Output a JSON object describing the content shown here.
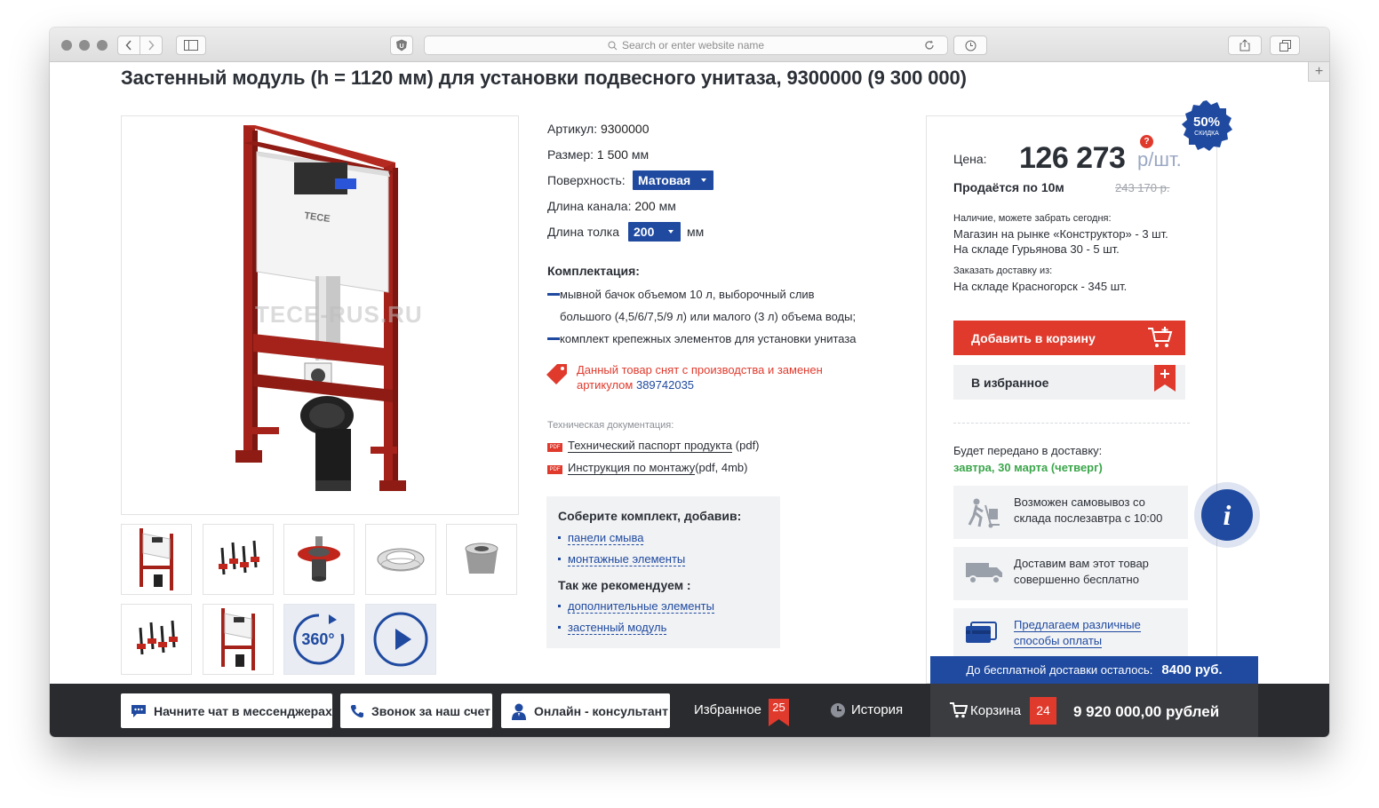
{
  "browser": {
    "address_placeholder": "Search or enter website name"
  },
  "product": {
    "title": "Застенный модуль (h = 1120 мм) для установки подвесного унитаза, 9300000 (9 300 000)",
    "watermark": "TECE-RUS.RU",
    "brand_mark": "TECE",
    "thumb_360": "360°"
  },
  "attributes": {
    "article_label": "Артикул:",
    "article_value": "9300000",
    "size_label": "Размер:",
    "size_value": "1 500",
    "size_unit": "мм",
    "surface_label": "Поверхность:",
    "surface_value": "Матовая",
    "channel_label": "Длина канала:",
    "channel_value": "200",
    "channel_unit": "мм",
    "push_label": "Длина толка",
    "push_value": "200",
    "push_unit": "мм"
  },
  "kit": {
    "title": "Комплектация:",
    "item1_line1": "мывной бачок объемом 10 л, выборочный слив",
    "item1_line2": "большого (4,5/6/7,5/9 л) или малого (3 л) объема воды;",
    "item2": "комплект крепежных элементов для установки унитаза"
  },
  "notice": {
    "line1": "Данный товар снят с производства и заменен",
    "line2_prefix": "артикулом",
    "replacement_article": "389742035"
  },
  "docs": {
    "heading": "Техническая документация:",
    "pdf_tag": "PDF",
    "doc1_link": "Технический паспорт продукта",
    "doc1_suffix": "(pdf)",
    "doc2_link": "Инструкция по монтажу",
    "doc2_suffix": "(pdf, 4mb)"
  },
  "combo": {
    "heading1": "Соберите комплект, добавив:",
    "link1": "панели смыва",
    "link2": "монтажные элементы",
    "heading2": "Так же рекомендуем :",
    "link3": "дополнительные элементы",
    "link4": "застенный модуль"
  },
  "pricing": {
    "discount": "50%",
    "discount_caption": "СКИДКА",
    "price_label": "Цена:",
    "price": "126 273",
    "unit": "р/шт.",
    "help": "?",
    "sold_by": "Продаётся по 10м",
    "old_price": "243 170 р."
  },
  "availability": {
    "heading": "Наличие, можете забрать сегодня:",
    "store1": "Магазин на рынке «Конструктор» - 3 шт.",
    "store2": "На складе Гурьянова 30 - 5 шт.",
    "order_heading": "Заказать доставку из:",
    "store3": "На складе Красногорск - 345 шт."
  },
  "actions": {
    "add_to_cart": "Добавить в корзину",
    "add_to_favorites": "В избранное"
  },
  "delivery": {
    "heading": "Будет передано в доставку:",
    "date": "завтра, 30 марта (четверг)",
    "pickup": "Возможен самовывоз со склада послезавтра с 10:00",
    "free": "Доставим вам этот товар совершенно бесплатно",
    "payment": "Предлагаем различные способы оплаты"
  },
  "bottom_bar": {
    "free_delivery_label": "До бесплатной доставки осталось:",
    "free_delivery_amount": "8400 руб.",
    "chat": "Начните чат в мессенджерах",
    "call": "Звонок за наш счет",
    "consultant": "Онлайн - консультант",
    "favorites": "Избранное",
    "favorites_count": "25",
    "history": "История",
    "cart": "Корзина",
    "cart_count": "24",
    "cart_total": "9 920 000,00 рублей"
  },
  "colors": {
    "brand_blue": "#1f4aa0",
    "accent_red": "#e03a2d",
    "success_green": "#3aa64a",
    "bar_dark": "#2a2b2e"
  }
}
